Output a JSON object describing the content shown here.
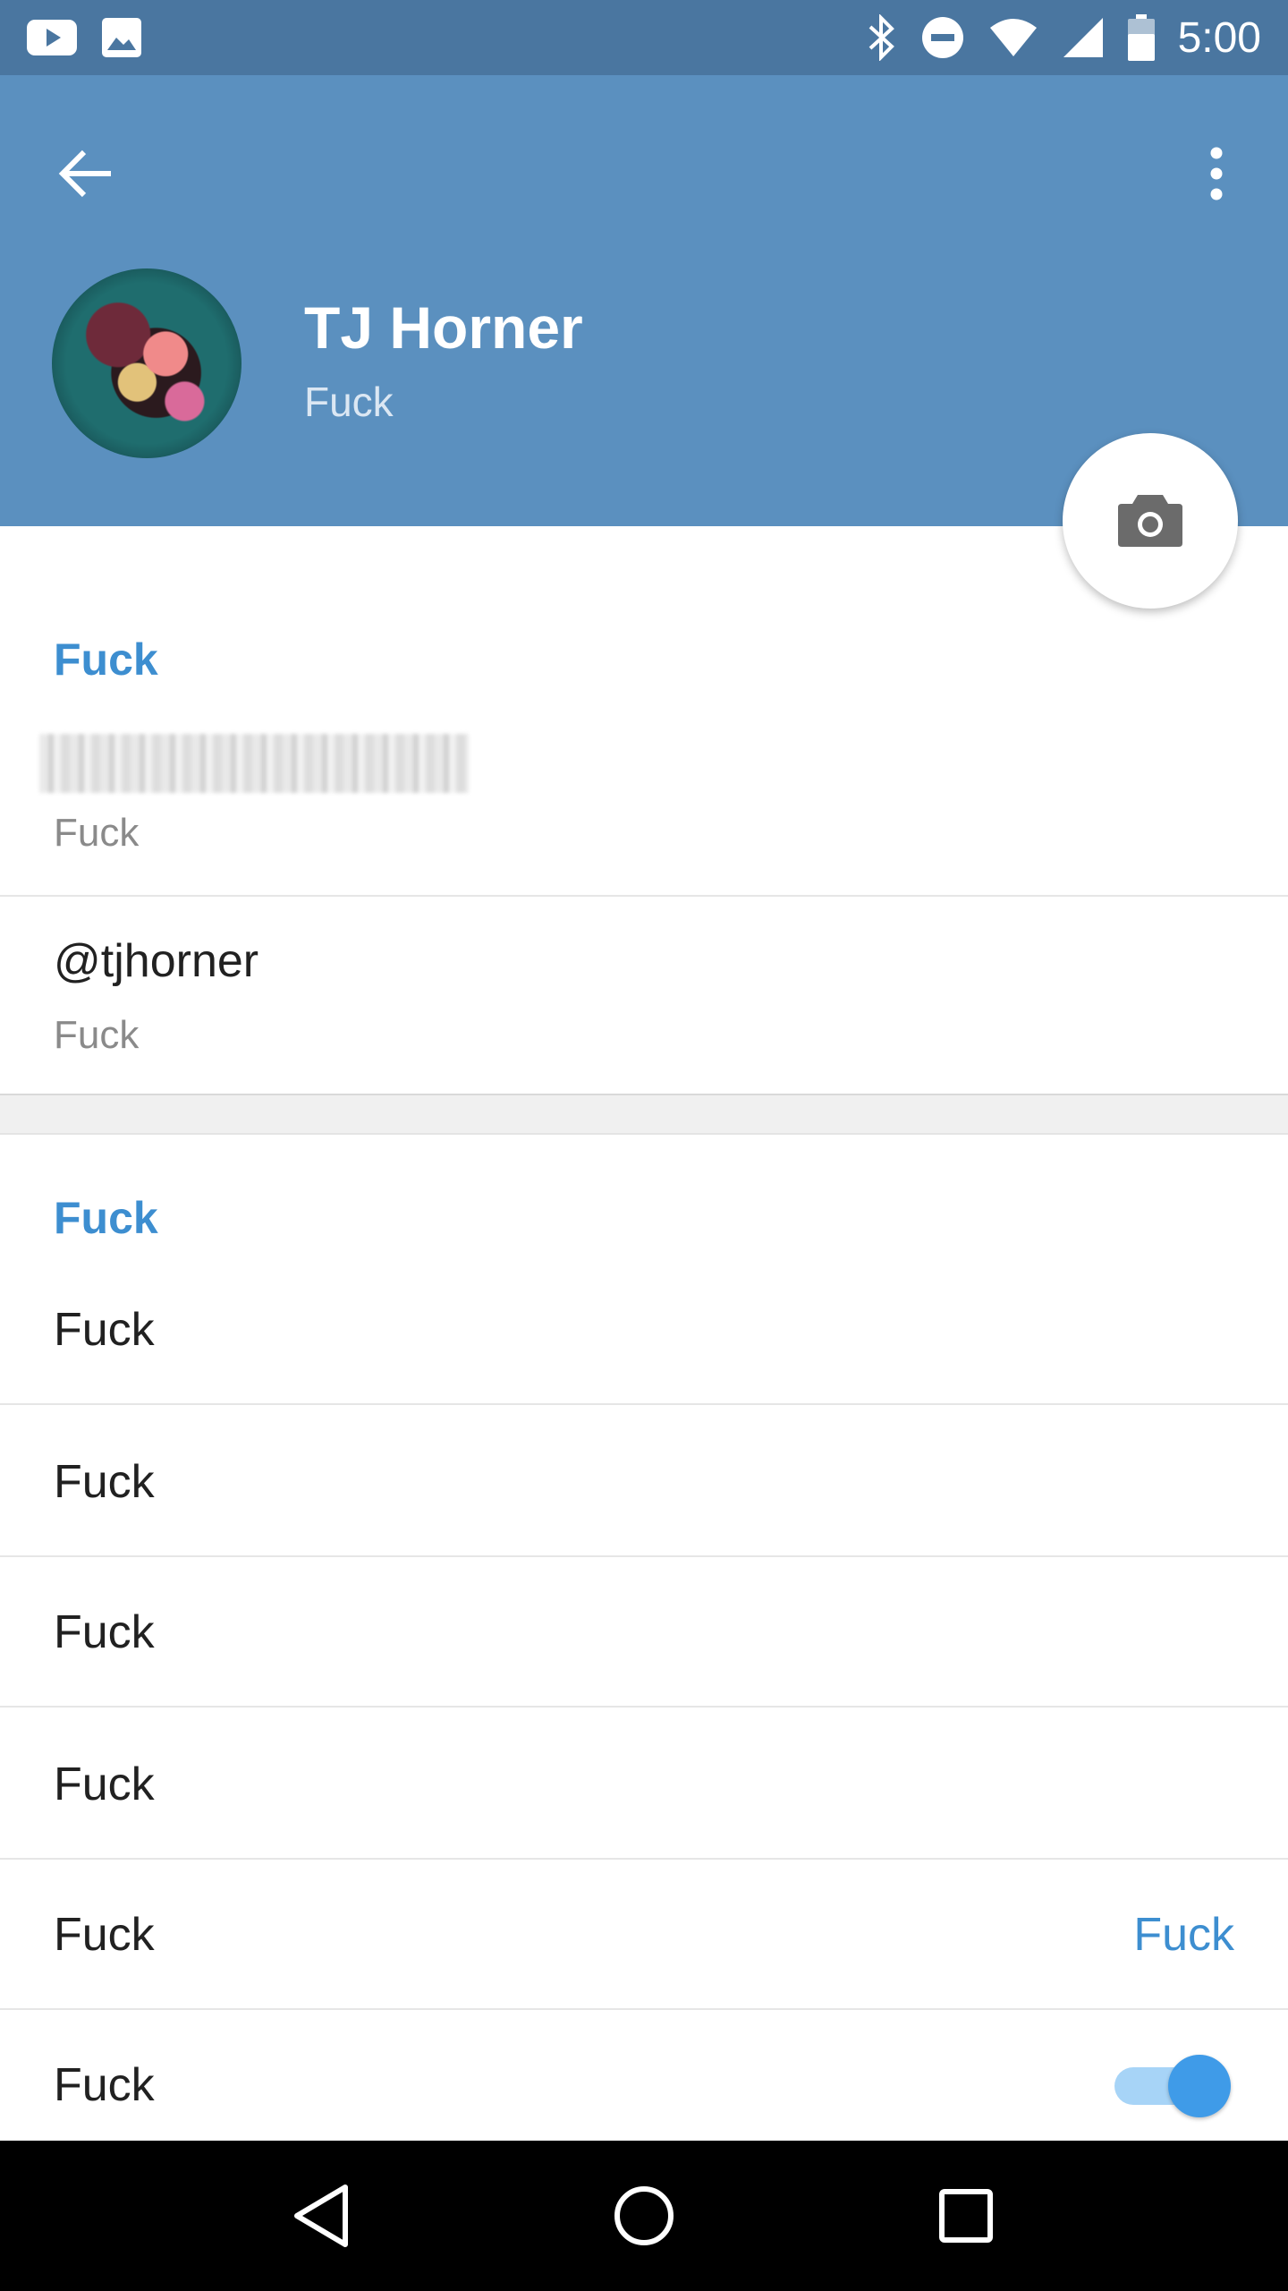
{
  "status_bar": {
    "time": "5:00",
    "left_icons": [
      "youtube-icon",
      "image-icon"
    ],
    "right_icons": [
      "bluetooth-icon",
      "do-not-disturb-icon",
      "wifi-icon",
      "signal-icon",
      "battery-icon"
    ]
  },
  "header": {
    "name": "TJ Horner",
    "status": "Fuck",
    "colors": {
      "header_bg": "#5b90bf",
      "status_bar_bg": "#4a76a0",
      "accent": "#3d8ed0"
    }
  },
  "info_section": {
    "title": "Fuck",
    "phone_label": "Fuck",
    "username": "@tjhorner",
    "username_label": "Fuck"
  },
  "settings_section": {
    "title": "Fuck",
    "rows": [
      {
        "label": "Fuck"
      },
      {
        "label": "Fuck"
      },
      {
        "label": "Fuck"
      },
      {
        "label": "Fuck"
      },
      {
        "label": "Fuck",
        "value": "Fuck"
      },
      {
        "label": "Fuck",
        "toggle": true
      }
    ]
  },
  "nav_bar": {
    "buttons": [
      "back-nav-icon",
      "home-nav-icon",
      "recents-nav-icon"
    ]
  }
}
